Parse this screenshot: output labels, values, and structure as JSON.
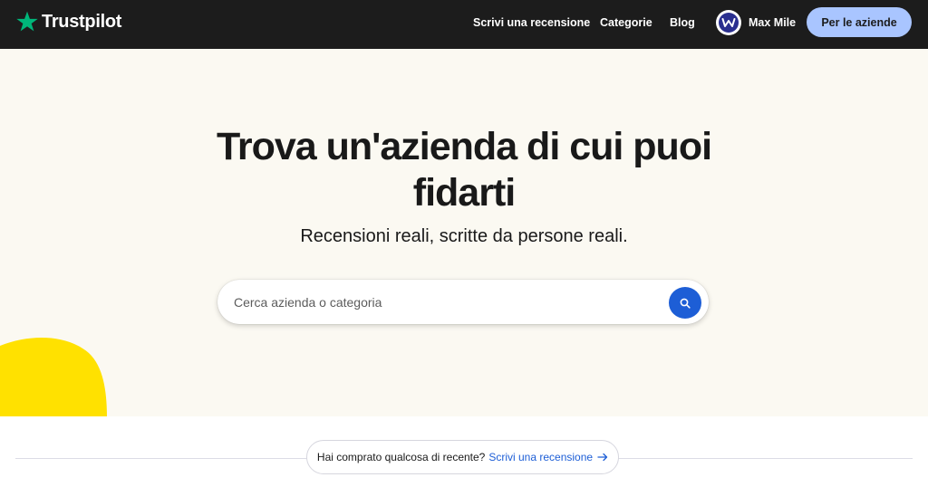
{
  "header": {
    "brand": "Trustpilot",
    "nav": [
      {
        "label": "Scrivi una recensione"
      },
      {
        "label": "Categorie"
      },
      {
        "label": "Blog"
      }
    ],
    "user": {
      "name": "Max Mile"
    },
    "business_button": "Per le aziende"
  },
  "hero": {
    "title_line1": "Trova un'azienda di cui puoi",
    "title_line2": "fidarti",
    "subtitle": "Recensioni reali, scritte da persone reali.",
    "search": {
      "placeholder": "Cerca azienda o categoria",
      "value": ""
    }
  },
  "prompt": {
    "question": "Hai comprato qualcosa di recente?",
    "link": "Scrivi una recensione"
  },
  "icons": {
    "logo": "star-icon",
    "search": "search-icon",
    "arrow": "arrow-right-icon"
  },
  "colors": {
    "header_bg": "#1c1c1c",
    "brand_green": "#00b67a",
    "hero_bg": "#fbf9f2",
    "business_button_bg": "#a9c5ff",
    "search_button_bg": "#1d5ed6",
    "link": "#1d5ed6",
    "blob": "#ffe100"
  }
}
